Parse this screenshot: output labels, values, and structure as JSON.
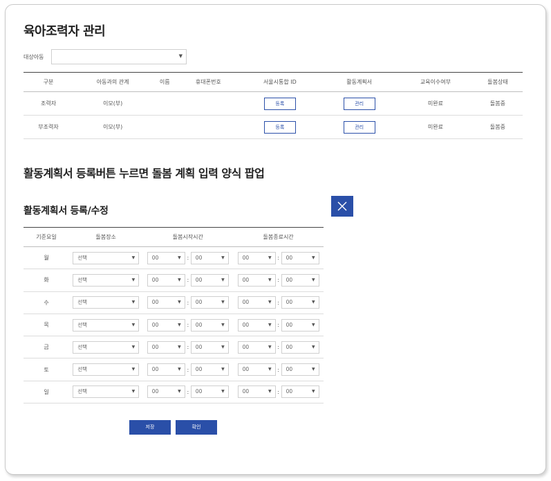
{
  "page": {
    "title": "육아조력자 관리"
  },
  "filter": {
    "label": "대상아동",
    "value": ""
  },
  "main_table": {
    "headers": [
      "구분",
      "아동과의 관계",
      "이름",
      "휴대폰번호",
      "서울시통합 ID",
      "활동계획서",
      "교육이수여부",
      "돌봄상태"
    ],
    "rows": [
      {
        "type": "조력자",
        "relation": "이모(부)",
        "name": "",
        "phone": "",
        "id_button": "등록",
        "plan_button": "관리",
        "edu": "미완료",
        "status": "돌봄중"
      },
      {
        "type": "부조력자",
        "relation": "이모(부)",
        "name": "",
        "phone": "",
        "id_button": "등록",
        "plan_button": "관리",
        "edu": "미완료",
        "status": "돌봄중"
      }
    ]
  },
  "description": "활동계획서 등록버튼 누르면 돌봄 계획 입력 양식 팝업",
  "popup": {
    "title": "활동계획서 등록/수정",
    "headers": [
      "기준요일",
      "돌봄장소",
      "돌봄시작시간",
      "돌봄종료시간"
    ],
    "place_default": "선택",
    "time_default": "00",
    "colon": ":",
    "days": [
      "월",
      "화",
      "수",
      "목",
      "금",
      "토",
      "일"
    ],
    "save_label": "저장",
    "confirm_label": "확인"
  },
  "icons": {
    "close": "close-icon",
    "caret": "chevron-down-icon"
  },
  "colors": {
    "accent": "#2a4fa8"
  }
}
